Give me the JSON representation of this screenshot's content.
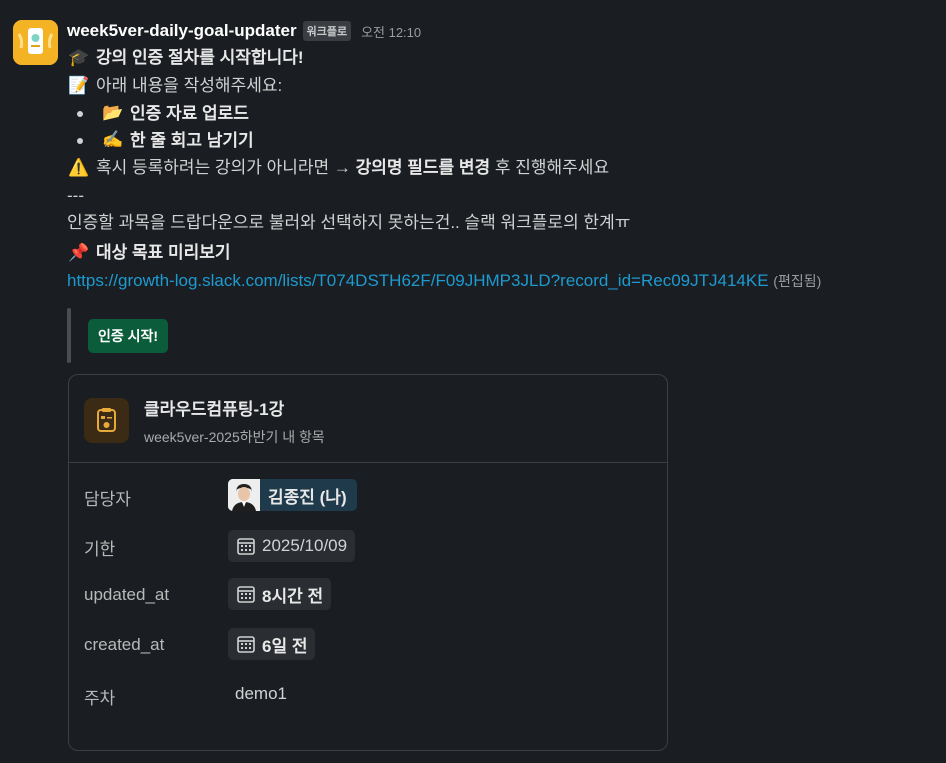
{
  "message": {
    "sender": "week5ver-daily-goal-updater",
    "app_badge": "워크플로",
    "time": "오전 12:10",
    "line1": {
      "emoji": "🎓",
      "text": "강의 인증 절차를 시작합니다!"
    },
    "line2": {
      "emoji": "📝",
      "text": "아래 내용을 작성해주세요:"
    },
    "bullets": [
      {
        "emoji": "📂",
        "text": "인증 자료 업로드"
      },
      {
        "emoji": "✍️",
        "text": "한 줄 회고 남기기"
      }
    ],
    "warning": {
      "emoji": "⚠️",
      "before": "혹시 등록하려는 강의가 아니라면 → ",
      "bold": "강의명 필드를 변경",
      "after": " 후 진행해주세요"
    },
    "separator": "---",
    "note": "인증할 과목을 드랍다운으로 불러와 선택하지 못하는건.. 슬랙 워크플로의 한계ㅠ",
    "preview": {
      "emoji": "📌",
      "text": "대상 목표 미리보기"
    },
    "link": "https://growth-log.slack.com/lists/T074DSTH62F/F09JHMP3JLD?record_id=Rec09JTJ414KE",
    "edited": "(편집됨)",
    "start_button": "인증 시작!"
  },
  "card": {
    "title": "클라우드컴퓨팅-1강",
    "subtitle": "week5ver-2025하반기 내 항목",
    "fields": {
      "assignee": {
        "label": "담당자",
        "value": "김종진 (나)"
      },
      "due": {
        "label": "기한",
        "value": "2025/10/09"
      },
      "updated": {
        "label": "updated_at",
        "value": "8시간 전"
      },
      "created": {
        "label": "created_at",
        "value": "6일 전"
      },
      "week": {
        "label": "주차",
        "value": "demo1"
      }
    }
  },
  "colors": {
    "background": "#1a1d21",
    "link": "#1d9bd1",
    "button": "#0b5c3b",
    "avatar": "#f4b324"
  }
}
